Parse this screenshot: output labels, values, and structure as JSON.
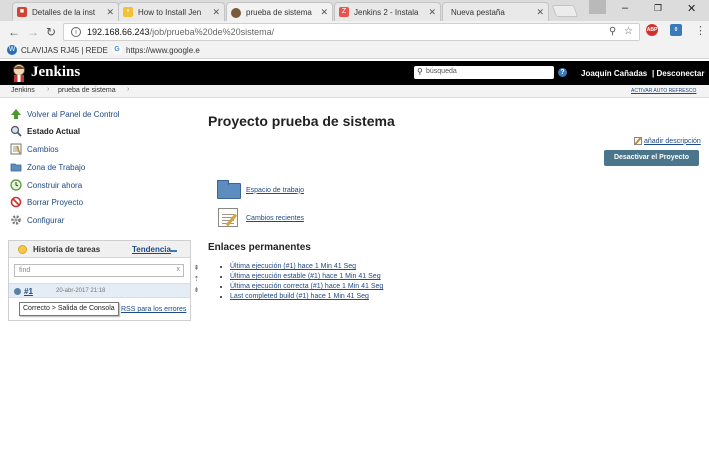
{
  "browser": {
    "tabs": [
      {
        "title": "Detalles de la inst",
        "favicon_color": "#d04437",
        "active": false
      },
      {
        "title": "How to Install Jen",
        "favicon_color": "#f3c133",
        "active": false
      },
      {
        "title": "prueba de sistema",
        "favicon_color": "#7a5a3a",
        "active": true
      },
      {
        "title": "Jenkins 2 - Instala",
        "favicon_color": "#e8544e",
        "active": false
      },
      {
        "title": "Nueva pestaña",
        "favicon_color": "",
        "active": false
      }
    ],
    "url_host": "192.168.66.243",
    "url_path": "/job/prueba%20de%20sistema/",
    "bookmarks": [
      {
        "label": "CLAVIJAS RJ45 | REDE",
        "color": "#2a6fb5"
      },
      {
        "label": "https://www.google.e",
        "color": "#4285f4"
      }
    ],
    "ext_abp": "ABP",
    "ext_badge": "0"
  },
  "jenkins": {
    "title": "Jenkins",
    "search_placeholder": "búsqueda",
    "help": "?",
    "user": "Joaquín Cañadas",
    "logout": "| Desconectar",
    "breadcrumbs": [
      "Jenkins",
      "prueba de sistema"
    ],
    "auto_refresh": "ACTIVAR AUTO REFRESCO"
  },
  "side": {
    "tasks": [
      {
        "label": "Volver al Panel de Control",
        "icon": "up-arrow-icon",
        "bold": false
      },
      {
        "label": "Estado Actual",
        "icon": "magnifier-icon",
        "bold": true
      },
      {
        "label": "Cambios",
        "icon": "notepad-icon",
        "bold": false
      },
      {
        "label": "Zona de Trabajo",
        "icon": "folder-icon",
        "bold": false
      },
      {
        "label": "Construir ahora",
        "icon": "clock-icon",
        "bold": false
      },
      {
        "label": "Borrar Proyecto",
        "icon": "no-entry-icon",
        "bold": false
      },
      {
        "label": "Configurar",
        "icon": "gear-icon",
        "bold": false
      }
    ],
    "history": {
      "title": "Historia de tareas",
      "trend": "Tendencia",
      "find_placeholder": "find",
      "clear": "x",
      "builds": [
        {
          "number": "#1",
          "date": "20-abr-2017 21:18"
        }
      ],
      "tooltip": "Correcto > Salida de Consola",
      "rss": "RSS para los errores"
    }
  },
  "main": {
    "title": "Proyecto prueba de sistema",
    "add_description": "añadir descripción",
    "disable_button": "Desactivar el Proyecto",
    "links": [
      {
        "label": "Espacio de trabajo",
        "icon": "folder-icon"
      },
      {
        "label": "Cambios recientes",
        "icon": "notepad-icon"
      }
    ],
    "permalinks_title": "Enlaces permanentes",
    "permalinks": [
      "Última ejecución (#1) hace 1 Min 41 Seg ",
      "Última ejecución estable (#1) hace 1 Min 41 Seg ",
      "Última ejecución correcta (#1) hace 1 Min 41 Seg ",
      "Last completed build (#1) hace 1 Min 41 Seg "
    ]
  }
}
